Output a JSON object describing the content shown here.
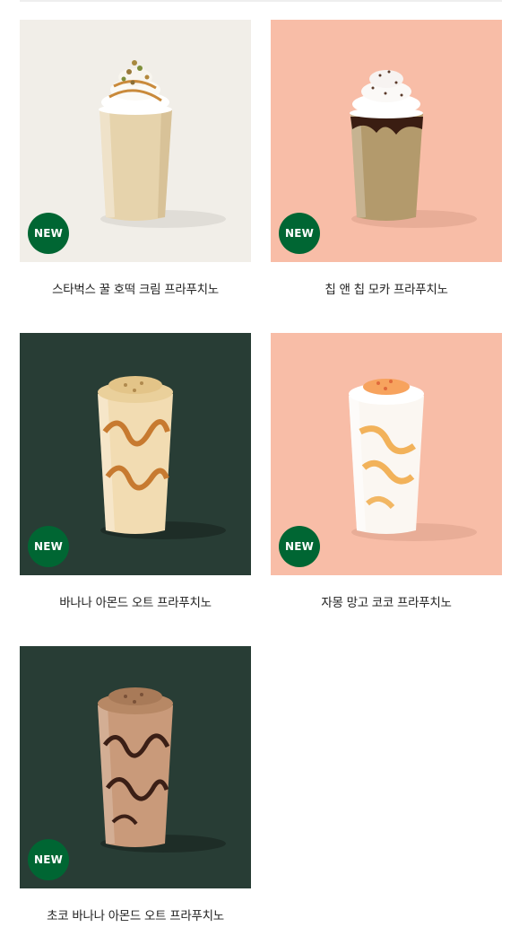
{
  "badge": {
    "label": "NEW",
    "color": "#006633"
  },
  "products": [
    {
      "name": "스타벅스 꿀 호떡 크림 프라푸치노",
      "background": "#f1eee8",
      "drink": "honey-hotteok-cream-frappuccino",
      "badge": "NEW"
    },
    {
      "name": "칩 앤 칩 모카 프라푸치노",
      "background": "#f8bda7",
      "drink": "chip-and-chip-mocha-frappuccino",
      "badge": "NEW"
    },
    {
      "name": "바나나 아몬드 오트 프라푸치노",
      "background": "#283d35",
      "drink": "banana-almond-oat-frappuccino",
      "badge": "NEW"
    },
    {
      "name": "자몽 망고 코코 프라푸치노",
      "background": "#f8bda7",
      "drink": "grapefruit-mango-coco-frappuccino",
      "badge": "NEW"
    },
    {
      "name": "초코 바나나 아몬드 오트 프라푸치노",
      "background": "#283d35",
      "drink": "choco-banana-almond-oat-frappuccino",
      "badge": "NEW"
    }
  ]
}
